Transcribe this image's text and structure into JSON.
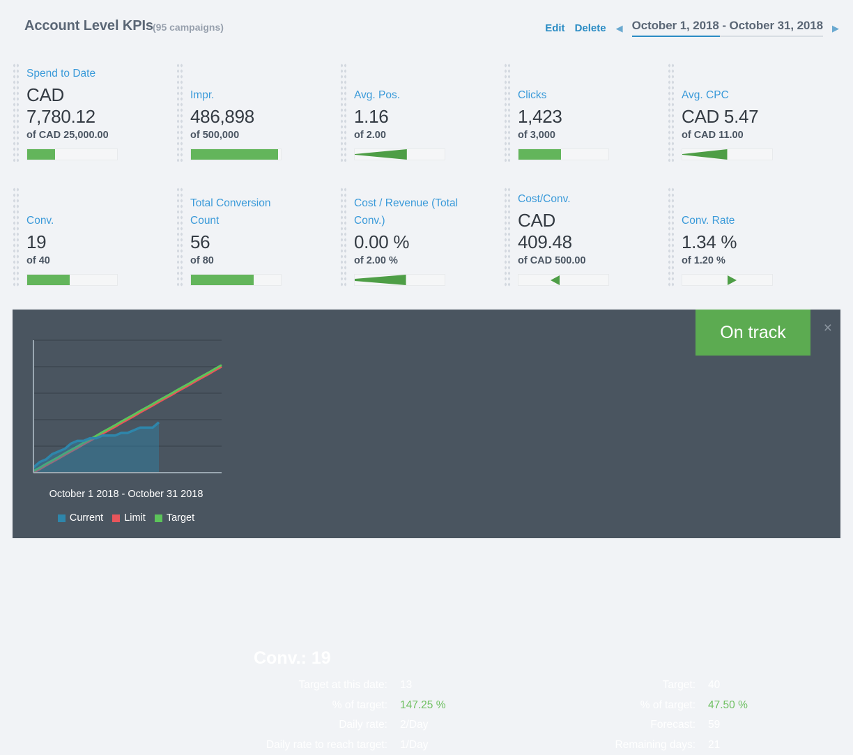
{
  "header": {
    "title": "Account Level KPIs",
    "campaign_count": "(95 campaigns)",
    "edit_label": "Edit",
    "delete_label": "Delete",
    "prev_icon": "◀",
    "next_icon": "▶",
    "date_range": "October 1, 2018 - October 31, 2018",
    "accent_color": "#2b8cc4"
  },
  "kpis": {
    "row1": [
      {
        "label": "Spend to Date",
        "value": "CAD\n7,780.12",
        "target": "of CAD 25,000.00",
        "indicator": "bar",
        "fill_percent": 31
      },
      {
        "label": "Impr.",
        "value": "486,898",
        "target": "of 500,000",
        "indicator": "bar",
        "fill_percent": 97
      },
      {
        "label": "Avg. Pos.",
        "value": "1.16",
        "target": "of 2.00",
        "indicator": "wedge-decreasing",
        "fill_percent": 58
      },
      {
        "label": "Clicks",
        "value": "1,423",
        "target": "of 3,000",
        "indicator": "bar",
        "fill_percent": 47
      },
      {
        "label": "Avg. CPC",
        "value": "CAD 5.47",
        "target": "of CAD 11.00",
        "indicator": "wedge-decreasing",
        "fill_percent": 50
      }
    ],
    "row2": [
      {
        "label": "Conv.",
        "value": "19",
        "target": "of 40",
        "indicator": "bar",
        "fill_percent": 47
      },
      {
        "label": "Total Conversion Count",
        "value": "56",
        "target": "of 80",
        "indicator": "bar",
        "fill_percent": 70
      },
      {
        "label": "Cost / Revenue (Total Conv.)",
        "value": "0.00 %",
        "target": "of 2.00 %",
        "indicator": "wedge-increasing",
        "fill_percent": 57
      },
      {
        "label": "Cost/Conv.",
        "value": "CAD\n409.48",
        "target": "of CAD 500.00",
        "indicator": "triangle-left",
        "fill_percent": 46
      },
      {
        "label": "Conv. Rate",
        "value": "1.34 %",
        "target": "of 1.20 %",
        "indicator": "triangle-right",
        "fill_percent": 55
      }
    ],
    "green": "#63b55b"
  },
  "detail": {
    "title": "Conv.: 19",
    "status": "On track",
    "status_color": "#5cab51",
    "close_icon": "×",
    "stats_left": [
      {
        "label": "Target at this date:",
        "value": "13",
        "highlight": false
      },
      {
        "label": "% of target:",
        "value": "147.25 %",
        "highlight": true
      },
      {
        "label": "Daily rate:",
        "value": "2/Day",
        "highlight": false
      },
      {
        "label": "Daily rate to reach target:",
        "value": "1/Day",
        "highlight": false
      }
    ],
    "stats_right": [
      {
        "label": "Target:",
        "value": "40",
        "highlight": false
      },
      {
        "label": "% of target:",
        "value": "47.50 %",
        "highlight": true
      },
      {
        "label": "Forecast:",
        "value": "59",
        "highlight": false
      },
      {
        "label": "Remaining days:",
        "value": "21",
        "highlight": false
      }
    ]
  },
  "chart_data": {
    "type": "area",
    "title": "",
    "caption": "October 1 2018 - October 31 2018",
    "xlabel": "",
    "ylabel": "",
    "x": [
      1,
      2,
      3,
      4,
      5,
      6,
      7,
      8,
      9,
      10,
      11,
      12,
      13,
      14,
      15,
      16,
      17,
      18,
      19,
      20,
      21,
      22,
      23,
      24,
      25,
      26,
      27,
      28,
      29,
      30,
      31
    ],
    "ylim": [
      0,
      50
    ],
    "grid": true,
    "legend_position": "bottom",
    "series": [
      {
        "name": "Current",
        "color": "#2e86ab",
        "values": [
          2,
          4,
          5,
          7,
          8,
          9,
          11,
          12,
          12,
          13,
          13,
          14,
          14,
          14,
          15,
          15,
          16,
          17,
          17,
          17,
          19,
          null,
          null,
          null,
          null,
          null,
          null,
          null,
          null,
          null,
          null
        ]
      },
      {
        "name": "Limit",
        "color": "#e8555b",
        "values": [
          0,
          1.3,
          2.7,
          4,
          5.3,
          6.7,
          8,
          9.3,
          10.7,
          12,
          13.3,
          14.7,
          16,
          17.3,
          18.7,
          20,
          21.3,
          22.7,
          24,
          25.3,
          26.7,
          28,
          29.3,
          30.7,
          32,
          33.3,
          34.7,
          36,
          37.3,
          38.7,
          40
        ]
      },
      {
        "name": "Target",
        "color": "#5cc45a",
        "values": [
          0.6,
          1.9,
          3.3,
          4.6,
          5.9,
          7.3,
          8.6,
          9.9,
          11.3,
          12.6,
          13.9,
          15.3,
          16.6,
          17.9,
          19.3,
          20.6,
          21.9,
          23.3,
          24.6,
          25.9,
          27.3,
          28.6,
          29.9,
          31.3,
          32.6,
          33.9,
          35.3,
          36.6,
          37.9,
          39.3,
          40.6
        ]
      }
    ],
    "legend": [
      {
        "name": "Current",
        "color": "#2e86ab"
      },
      {
        "name": "Limit",
        "color": "#e8555b"
      },
      {
        "name": "Target",
        "color": "#5cc45a"
      }
    ]
  }
}
